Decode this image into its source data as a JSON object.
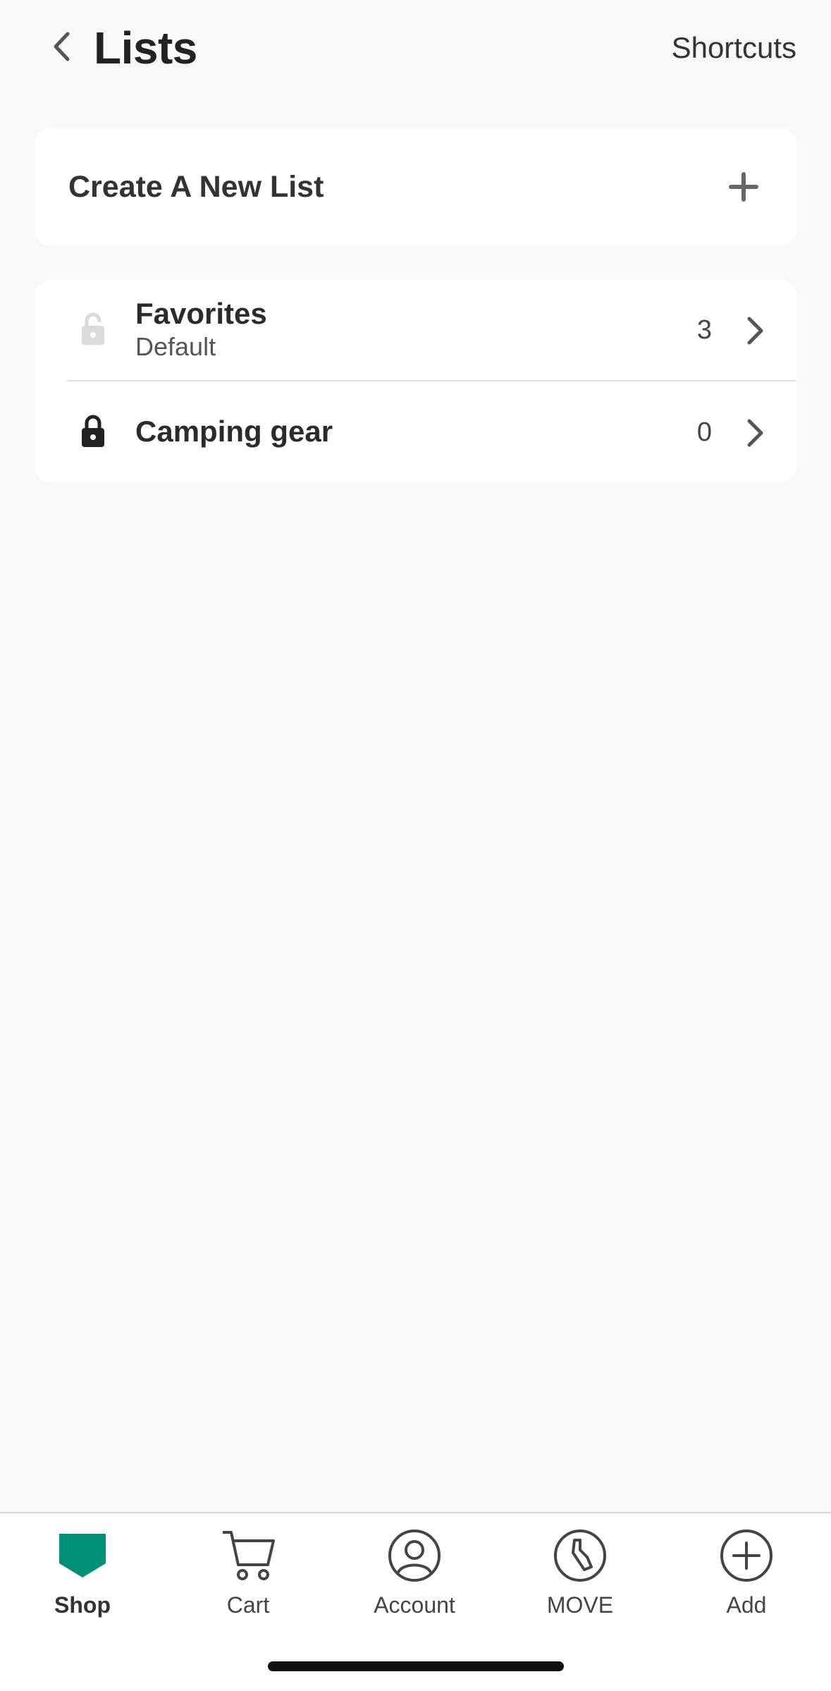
{
  "header": {
    "title": "Lists",
    "shortcuts_label": "Shortcuts"
  },
  "create": {
    "label": "Create A New List"
  },
  "lists": [
    {
      "name": "Favorites",
      "subtitle": "Default",
      "count": "3",
      "lock_state": "unlocked"
    },
    {
      "name": "Camping gear",
      "subtitle": "",
      "count": "0",
      "lock_state": "locked"
    }
  ],
  "tabbar": {
    "tabs": [
      {
        "label": "Shop",
        "icon": "shop-icon",
        "active": true
      },
      {
        "label": "Cart",
        "icon": "cart-icon",
        "active": false
      },
      {
        "label": "Account",
        "icon": "account-icon",
        "active": false
      },
      {
        "label": "MOVE",
        "icon": "move-icon",
        "active": false
      },
      {
        "label": "Add",
        "icon": "add-circle-icon",
        "active": false
      }
    ]
  },
  "colors": {
    "brand": "#008f77",
    "background": "#f8f8f8"
  }
}
